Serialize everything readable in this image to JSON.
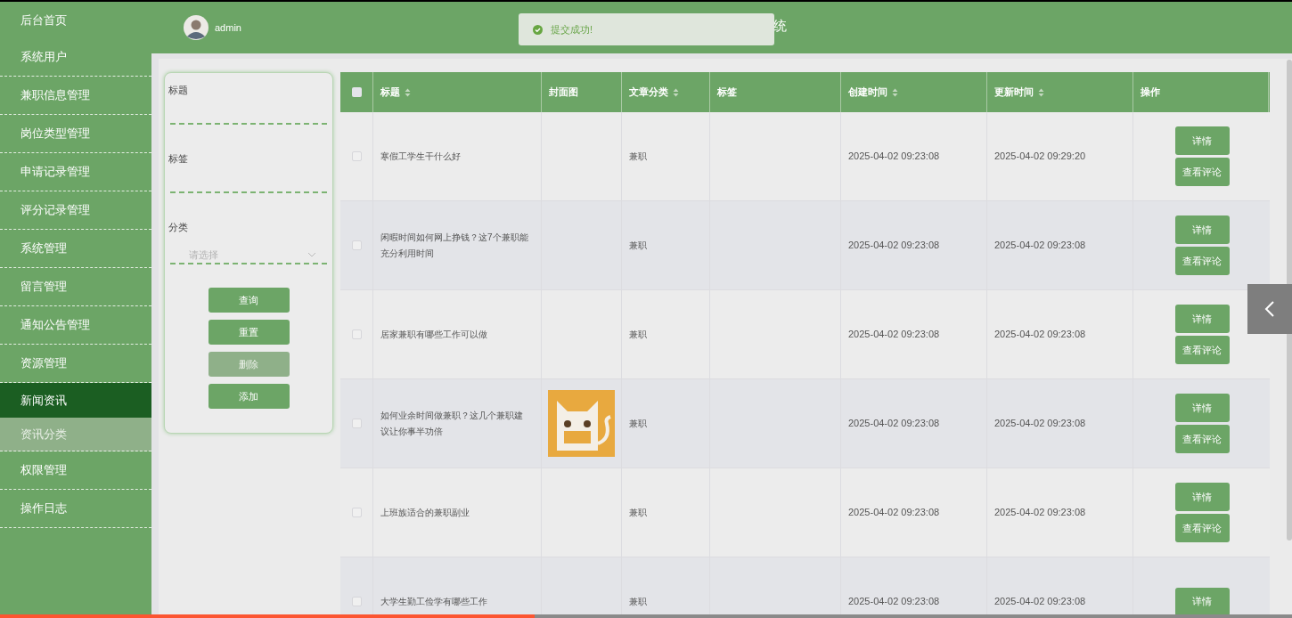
{
  "sidebar": {
    "items": [
      {
        "label": "后台首页",
        "expanded": false
      },
      {
        "label": "系统用户",
        "expanded": false
      },
      {
        "label": "兼职信息管理",
        "expanded": false
      },
      {
        "label": "岗位类型管理",
        "expanded": false
      },
      {
        "label": "申请记录管理",
        "expanded": false
      },
      {
        "label": "评分记录管理",
        "expanded": false
      },
      {
        "label": "系统管理",
        "expanded": false
      },
      {
        "label": "留言管理",
        "expanded": false
      },
      {
        "label": "通知公告管理",
        "expanded": false
      },
      {
        "label": "资源管理",
        "expanded": false
      },
      {
        "label": "新闻资讯",
        "expanded": true,
        "children": [
          {
            "label": "资讯分类"
          }
        ]
      },
      {
        "label": "权限管理",
        "expanded": false
      },
      {
        "label": "操作日志",
        "expanded": false
      }
    ]
  },
  "header": {
    "user": "admin",
    "title": "统"
  },
  "toast": {
    "message": "提交成功!"
  },
  "search": {
    "fields": [
      {
        "kind": "text",
        "label": "标题"
      },
      {
        "kind": "text",
        "label": "标签"
      },
      {
        "kind": "select",
        "label": "分类",
        "placeholder": "请选择"
      }
    ],
    "buttons": [
      {
        "label": "查询",
        "disabled": false
      },
      {
        "label": "重置",
        "disabled": false
      },
      {
        "label": "删除",
        "disabled": true
      },
      {
        "label": "添加",
        "disabled": false
      }
    ]
  },
  "table": {
    "select_all_checked": false,
    "columns": [
      {
        "label": "标题",
        "sortable": true
      },
      {
        "label": "封面图",
        "sortable": false
      },
      {
        "label": "文章分类",
        "sortable": true
      },
      {
        "label": "标签",
        "sortable": false
      },
      {
        "label": "创建时间",
        "sortable": true
      },
      {
        "label": "更新时间",
        "sortable": true
      },
      {
        "label": "操作",
        "sortable": false
      }
    ],
    "rows": [
      {
        "checked": false,
        "title": "寒假工学生干什么好",
        "category": "兼职",
        "created": "2025-04-02 09:23:08",
        "updated": "2025-04-02 09:29:20",
        "actions": [
          "详情",
          "查看评论"
        ]
      },
      {
        "checked": false,
        "title": "闲暇时间如何网上挣钱？这7个兼职能充分利用时间",
        "category": "兼职",
        "created": "2025-04-02 09:23:08",
        "updated": "2025-04-02 09:23:08",
        "actions": [
          "详情",
          "查看评论"
        ]
      },
      {
        "checked": false,
        "title": "居家兼职有哪些工作可以做",
        "category": "兼职",
        "created": "2025-04-02 09:23:08",
        "updated": "2025-04-02 09:23:08",
        "actions": [
          "详情",
          "查看评论"
        ]
      },
      {
        "checked": false,
        "title": "如何业余时间做兼职？这几个兼职建议让你事半功倍",
        "cover": {
          "kind": "picture"
        },
        "category": "兼职",
        "created": "2025-04-02 09:23:08",
        "updated": "2025-04-02 09:23:08",
        "actions": [
          "详情",
          "查看评论"
        ]
      },
      {
        "checked": false,
        "title": "上班族适合的兼职副业",
        "category": "兼职",
        "created": "2025-04-02 09:23:08",
        "updated": "2025-04-02 09:23:08",
        "actions": [
          "详情",
          "查看评论"
        ]
      },
      {
        "checked": false,
        "title": "大学生勤工俭学有哪些工作",
        "category": "兼职",
        "created": "2025-04-02 09:23:08",
        "updated": "2025-04-02 09:23:08",
        "actions": [
          "详情"
        ]
      }
    ]
  },
  "video_progress": {
    "level": 0.414
  }
}
